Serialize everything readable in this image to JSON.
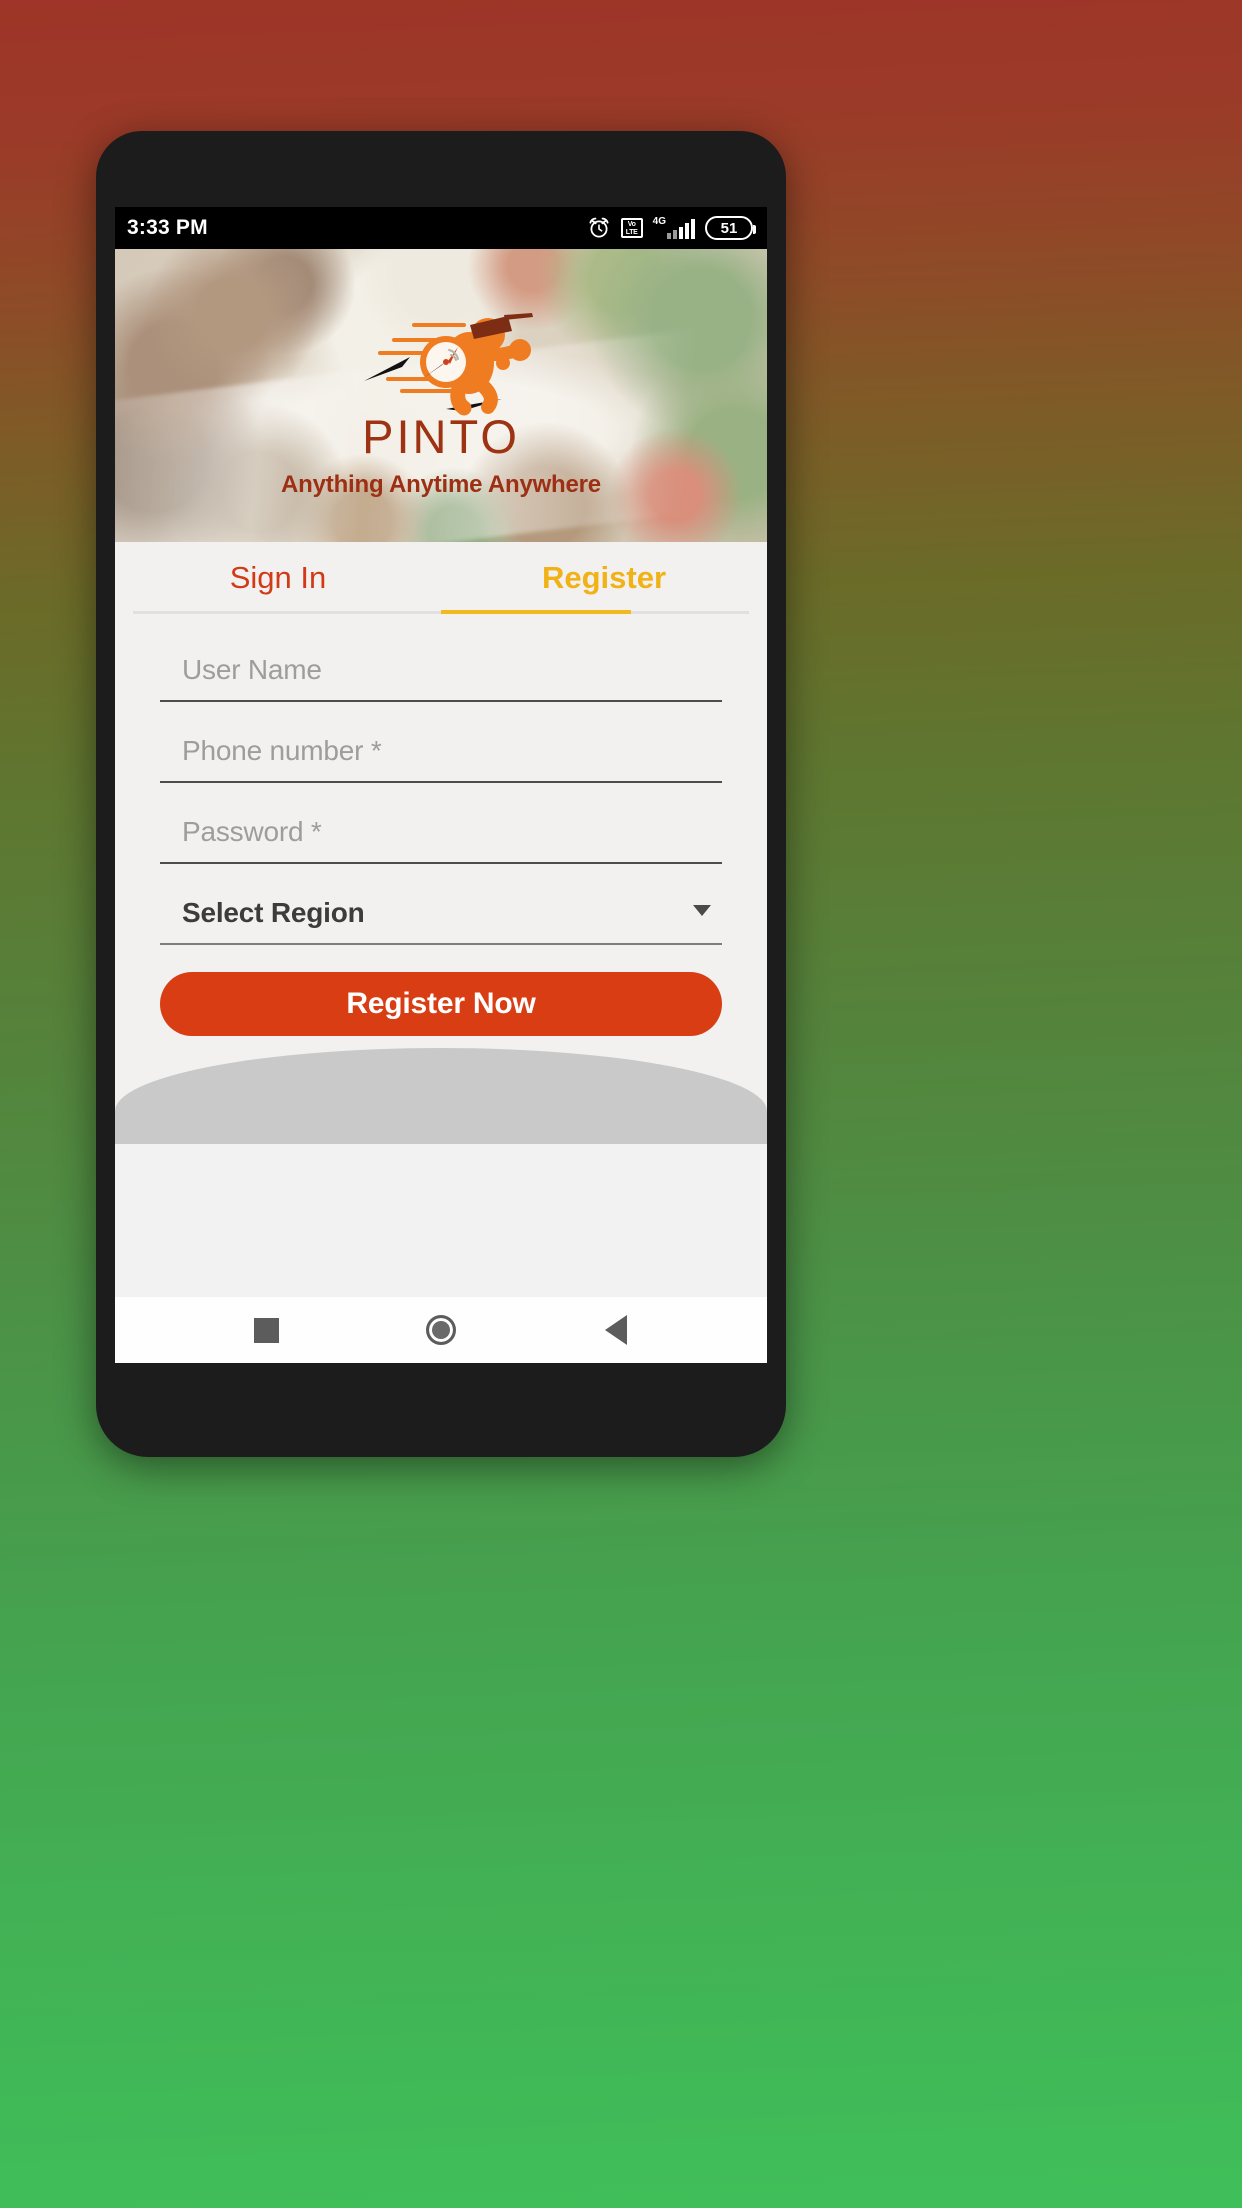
{
  "status_bar": {
    "clock": "3:33 PM",
    "alarm_icon": "alarm-clock-icon",
    "volte_icon_line1": "Vo",
    "volte_icon_line2": "LTE",
    "network_type": "4G",
    "battery_level": "51"
  },
  "hero": {
    "brand_name": "PINTO",
    "tagline": "Anything Anytime Anywhere",
    "logo_icon": "pinto-running-courier-logo",
    "brand_color": "#9e3313",
    "tagline_color": "#9c2f14",
    "logo_orange": "#f07c22"
  },
  "tabs": [
    {
      "label": "Sign In",
      "active": false,
      "color": "#d23a16"
    },
    {
      "label": "Register",
      "active": true,
      "color": "#f0b216"
    }
  ],
  "form": {
    "fields": [
      {
        "name": "user-name",
        "placeholder": "User Name",
        "value": "",
        "filled": false
      },
      {
        "name": "phone-number",
        "placeholder": "Phone number *",
        "value": "",
        "filled": false
      },
      {
        "name": "password",
        "placeholder": "Password *",
        "value": "",
        "filled": false
      }
    ],
    "select_region": {
      "label": "Select Region",
      "caret_icon": "chevron-down-icon"
    },
    "submit_label": "Register Now",
    "submit_color": "#d93d14"
  },
  "nav_bar": {
    "recent_label": "recent-apps",
    "home_label": "home",
    "back_label": "back"
  }
}
